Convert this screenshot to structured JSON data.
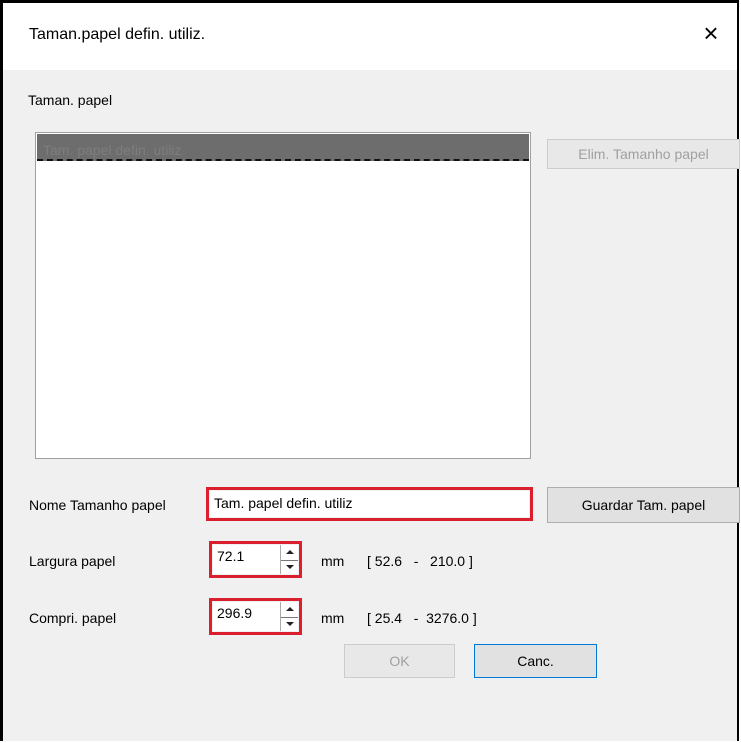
{
  "window": {
    "title": "Taman.papel defin. utiliz.",
    "close_icon": "×"
  },
  "list_section": {
    "label": "Taman. papel",
    "items": [
      "Tam. papel defin. utiliz"
    ]
  },
  "buttons": {
    "delete": "Elim. Tamanho papel",
    "save": "Guardar Tam. papel",
    "ok": "OK",
    "cancel": "Canc."
  },
  "name_field": {
    "label": "Nome Tamanho papel",
    "value": "Tam. papel defin. utiliz"
  },
  "width_field": {
    "label": "Largura papel",
    "value": "72.1",
    "unit": "mm",
    "range": "[ 52.6   -   210.0 ]"
  },
  "length_field": {
    "label": "Compri. papel",
    "value": "296.9",
    "unit": "mm",
    "range": "[ 25.4   -  3276.0 ]"
  },
  "colors": {
    "highlight": "#d9202c",
    "selection": "#6d6d6d"
  }
}
